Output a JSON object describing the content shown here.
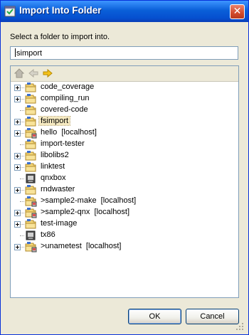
{
  "window": {
    "title": "Import Into Folder",
    "close_glyph": "✕"
  },
  "prompt": "Select a folder to import into.",
  "folder_field": {
    "value": "simport"
  },
  "toolbar": {
    "icons": [
      "home-icon",
      "back-arrow-icon",
      "forward-arrow-icon"
    ]
  },
  "tree": {
    "items": [
      {
        "label": "code_coverage",
        "expandable": true,
        "icon": "project-folder"
      },
      {
        "label": "compiling_run",
        "expandable": true,
        "icon": "project-folder"
      },
      {
        "label": "covered-code",
        "expandable": false,
        "icon": "project-folder"
      },
      {
        "label": "fsimport",
        "expandable": true,
        "icon": "project-folder",
        "selected": true
      },
      {
        "label": "hello  [localhost]",
        "expandable": true,
        "icon": "remote-project-folder"
      },
      {
        "label": "import-tester",
        "expandable": false,
        "icon": "project-folder"
      },
      {
        "label": "libolibs2",
        "expandable": true,
        "icon": "project-folder"
      },
      {
        "label": "linktest",
        "expandable": true,
        "icon": "project-folder"
      },
      {
        "label": "qnxbox",
        "expandable": false,
        "icon": "target-box"
      },
      {
        "label": "rndwaster",
        "expandable": true,
        "icon": "project-folder"
      },
      {
        "label": ">sample2-make  [localhost]",
        "expandable": false,
        "icon": "remote-project-folder"
      },
      {
        "label": ">sample2-qnx  [localhost]",
        "expandable": true,
        "icon": "remote-project-folder"
      },
      {
        "label": "test-image",
        "expandable": true,
        "icon": "project-folder"
      },
      {
        "label": "tx86",
        "expandable": false,
        "icon": "target-box"
      },
      {
        "label": ">unametest  [localhost]",
        "expandable": true,
        "icon": "remote-project-folder"
      }
    ]
  },
  "buttons": {
    "ok": "OK",
    "cancel": "Cancel"
  }
}
